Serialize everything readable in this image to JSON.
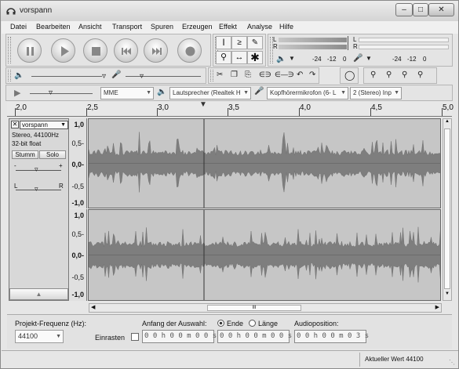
{
  "window": {
    "title": "vorspann"
  },
  "menu": [
    "Datei",
    "Bearbeiten",
    "Ansicht",
    "Transport",
    "Spuren",
    "Erzeugen",
    "Effekt",
    "Analyse",
    "Hilfe"
  ],
  "meter": {
    "channel_l": "L",
    "channel_r": "R",
    "playback_ticks": [
      "-24",
      "-12",
      "0"
    ],
    "record_ticks": [
      "-24",
      "-12",
      "0"
    ]
  },
  "device": {
    "host": "MME",
    "output": "Lautsprecher (Realtek H",
    "input": "Kopfhörermikrofon (6- L",
    "channels": "2 (Stereo) Inp"
  },
  "ruler": {
    "labels": [
      "2,0",
      "2,5",
      "3,0",
      "3,5",
      "4,0",
      "4,5",
      "5,0"
    ]
  },
  "track": {
    "name": "vorspann",
    "info_line1": "Stereo, 44100Hz",
    "info_line2": "32-bit float",
    "mute_label": "Stumm",
    "solo_label": "Solo",
    "gain_minus": "-",
    "gain_plus": "+",
    "pan_left": "L",
    "pan_right": "R",
    "scale": [
      "1,0",
      "0,5-",
      "0,0-",
      "-0,5",
      "-1,0"
    ]
  },
  "hscroll_label": "III",
  "selection": {
    "rate_label": "Projekt-Frequenz (Hz):",
    "rate_value": "44100",
    "snap_label": "Einrasten",
    "start_label": "Anfang der Auswahl:",
    "end_option": "Ende",
    "length_option": "Länge",
    "position_label": "Audioposition:",
    "start_value": "0 0 h 0 0 m 0 0 s",
    "end_value": "0 0 h 0 0 m 0 0 s",
    "position_value": "0 0 h 0 0 m 0 3 s"
  },
  "status": {
    "right": "Aktueller Wert 44100"
  }
}
